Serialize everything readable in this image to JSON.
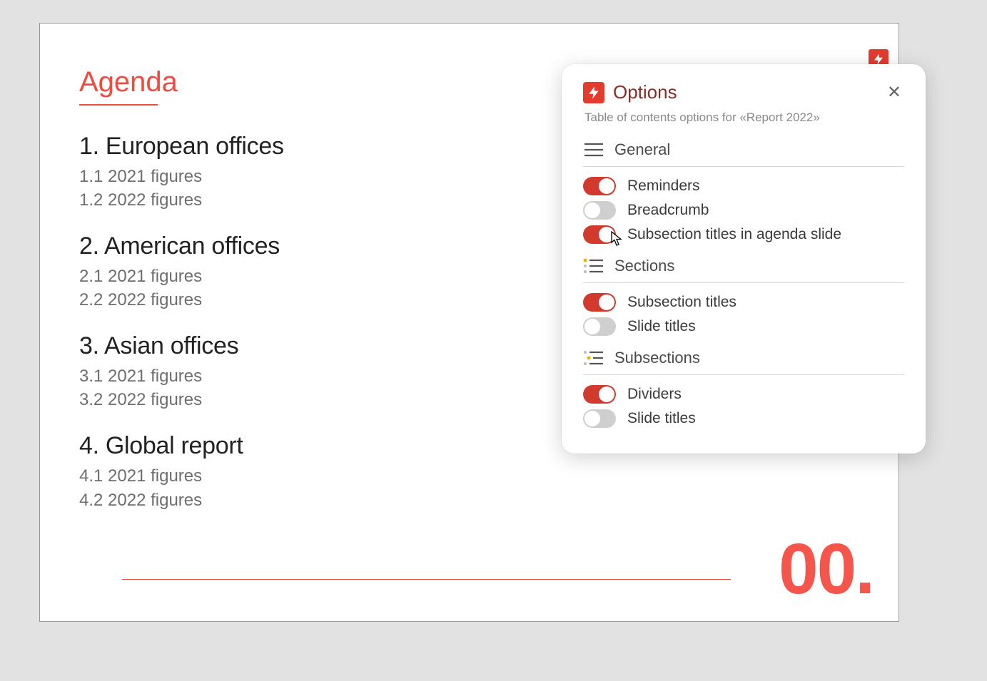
{
  "slide": {
    "title": "Agenda",
    "number": "00.",
    "sections": [
      {
        "title": "1. European offices",
        "subs": [
          "1.1 2021 figures",
          "1.2 2022 figures"
        ]
      },
      {
        "title": "2. American offices",
        "subs": [
          "2.1 2021 figures",
          "2.2 2022 figures"
        ]
      },
      {
        "title": "3. Asian offices",
        "subs": [
          "3.1 2021 figures",
          "3.2 2022 figures"
        ]
      },
      {
        "title": "4. Global report",
        "subs": [
          "4.1 2021 figures",
          "4.2 2022 figures"
        ]
      }
    ]
  },
  "panel": {
    "title": "Options",
    "subtitle": "Table of contents options for «Report 2022»",
    "groups": {
      "general": {
        "label": "General",
        "options": [
          {
            "label": "Reminders",
            "on": true
          },
          {
            "label": "Breadcrumb",
            "on": false
          },
          {
            "label": "Subsection titles in agenda slide",
            "on": true,
            "cursor": true
          }
        ]
      },
      "sections": {
        "label": "Sections",
        "options": [
          {
            "label": "Subsection titles",
            "on": true
          },
          {
            "label": "Slide titles",
            "on": false
          }
        ]
      },
      "subsections": {
        "label": "Subsections",
        "options": [
          {
            "label": "Dividers",
            "on": true
          },
          {
            "label": "Slide titles",
            "on": false
          }
        ]
      }
    }
  },
  "colors": {
    "accent": "#f14a3e",
    "accentDark": "#d13a2d",
    "panelTitle": "#8b2c22"
  }
}
